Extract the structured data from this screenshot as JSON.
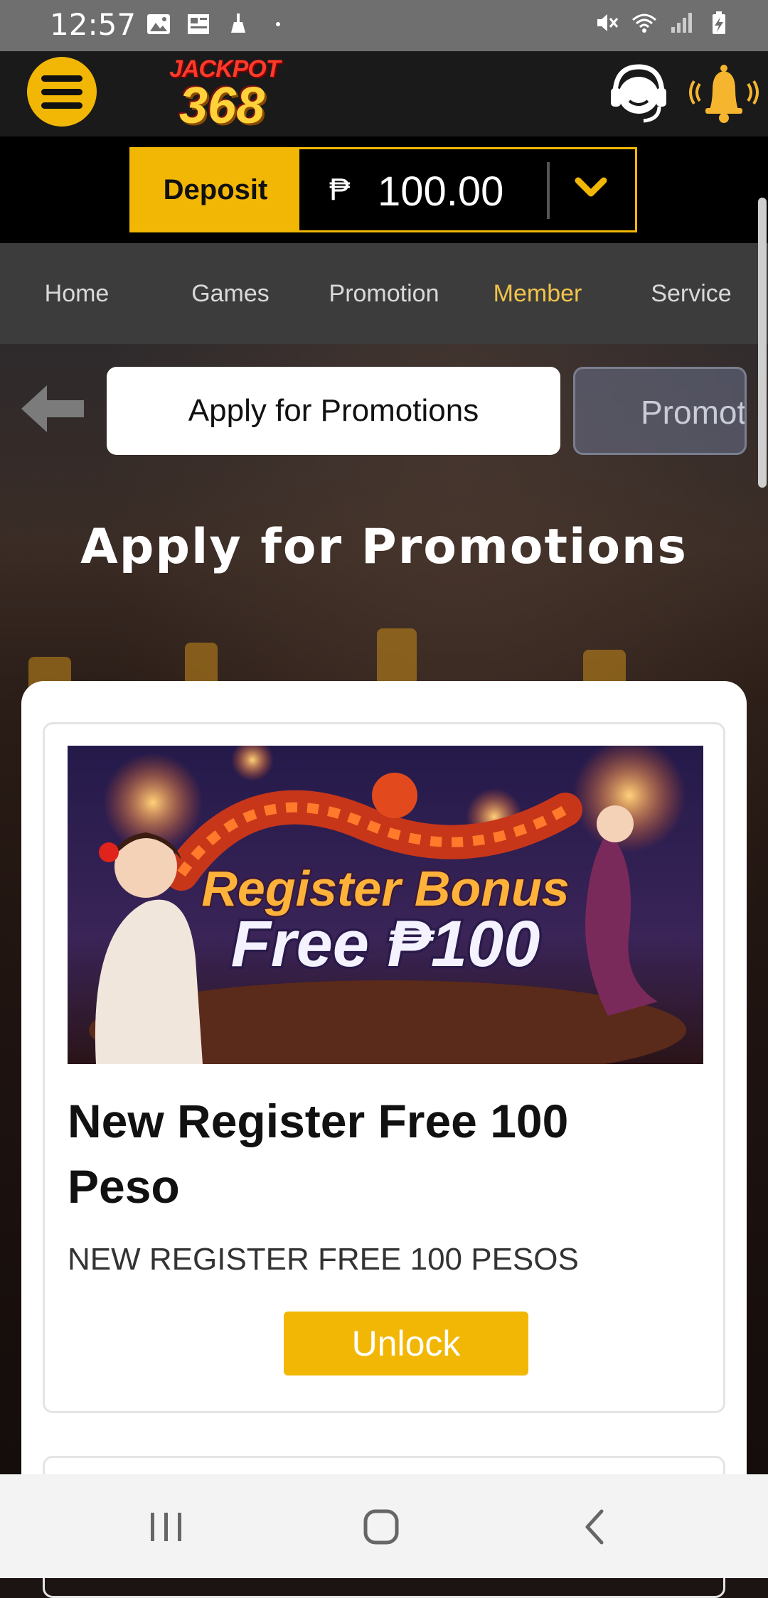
{
  "status_bar": {
    "time": "12:57"
  },
  "header": {
    "logo_top": "JACKPOT",
    "logo_number": "368",
    "icons": [
      "menu-icon",
      "headset-icon",
      "bell-icon"
    ]
  },
  "wallet": {
    "deposit_label": "Deposit",
    "currency_symbol": "₱",
    "balance": "100.00"
  },
  "nav": {
    "tabs": [
      {
        "label": "Home"
      },
      {
        "label": "Games"
      },
      {
        "label": "Promotion"
      },
      {
        "label": "Member"
      },
      {
        "label": "Service"
      }
    ],
    "active": "Member"
  },
  "subtabs": {
    "current": "Apply for Promotions",
    "next": "Promot"
  },
  "page": {
    "heading": "Apply for Promotions"
  },
  "promo": {
    "banner_line1": "Register Bonus",
    "banner_line2": "Free ₱100",
    "title": "New Register Free 100 Peso",
    "description": "NEW REGISTER FREE 100 PESOS",
    "unlock_label": "Unlock"
  },
  "colors": {
    "accent": "#f2b705",
    "active_tab": "#f2c34a",
    "header_bg": "#1a1a1a",
    "nav_bg": "#3c3c3c"
  }
}
